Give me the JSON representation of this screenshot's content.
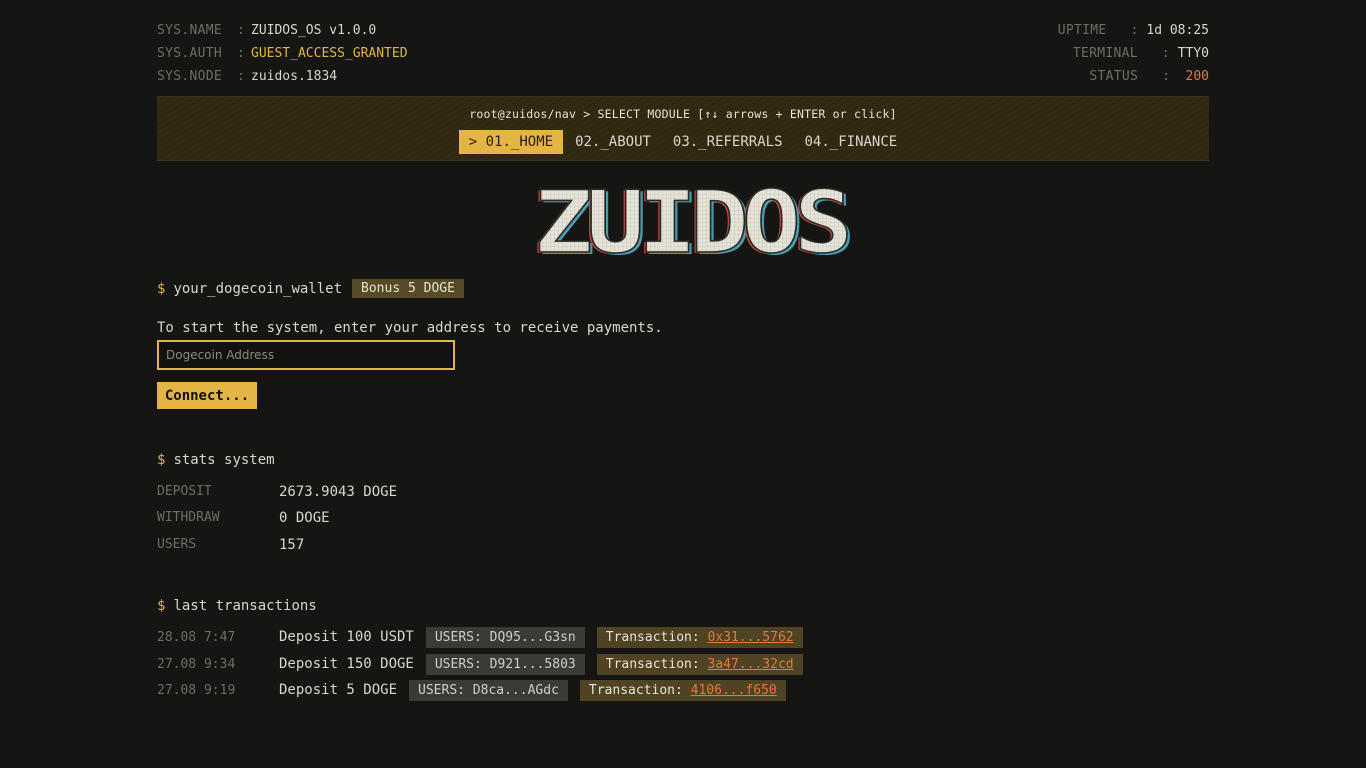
{
  "sys": {
    "left": [
      {
        "key": "SYS.NAME",
        "sep": ":",
        "value": "ZUIDOS_OS v1.0.0"
      },
      {
        "key": "SYS.AUTH",
        "sep": ":",
        "value": "GUEST_ACCESS_GRANTED"
      },
      {
        "key": "SYS.NODE",
        "sep": ":",
        "value": "zuidos.1834"
      }
    ],
    "right": [
      {
        "key": "UPTIME",
        "sep": ":",
        "value": "1d 08:25"
      },
      {
        "key": "TERMINAL",
        "sep": ":",
        "value": "TTY0"
      },
      {
        "key": "STATUS",
        "sep": ":",
        "value": "200"
      }
    ]
  },
  "nav": {
    "prompt": "root@zuidos/nav > SELECT MODULE [↑↓ arrows + ENTER or click]",
    "tabs": [
      {
        "label": "> 01._HOME",
        "active": true
      },
      {
        "label": "02._ABOUT",
        "active": false
      },
      {
        "label": "03._REFERRALS",
        "active": false
      },
      {
        "label": "04._FINANCE",
        "active": false
      }
    ]
  },
  "logo": {
    "text": "ZUIDOS"
  },
  "wallet": {
    "prompt_symbol": "$",
    "prompt": "your_dogecoin_wallet",
    "bonus": "Bonus 5 DOGE",
    "hint": "To start the system, enter your address to receive payments.",
    "placeholder": "Dogecoin Address",
    "value": "",
    "connect_label": "Connect..."
  },
  "stats": {
    "prompt_symbol": "$",
    "prompt": "stats system",
    "rows": [
      {
        "key": "DEPOSIT",
        "value": "2673.9043 DOGE"
      },
      {
        "key": "WITHDRAW",
        "value": "0 DOGE"
      },
      {
        "key": "USERS",
        "value": "157"
      }
    ]
  },
  "transactions": {
    "prompt_symbol": "$",
    "prompt": "last transactions",
    "rows": [
      {
        "time": "28.08 7:47",
        "desc": "Deposit 100 USDT",
        "user": "USERS: DQ95...G3sn",
        "trans_label": "Transaction:",
        "hash": "0x31...5762"
      },
      {
        "time": "27.08 9:34",
        "desc": "Deposit 150 DOGE",
        "user": "USERS: D921...5803",
        "trans_label": "Transaction:",
        "hash": "3a47...32cd"
      },
      {
        "time": "27.08 9:19",
        "desc": "Deposit 5 DOGE",
        "user": "USERS: D8ca...AGdc",
        "trans_label": "Transaction:",
        "hash": "4106...f650"
      }
    ]
  },
  "colors": {
    "accent": "#e2b544",
    "status": "#e3793f",
    "background": "#151513"
  }
}
